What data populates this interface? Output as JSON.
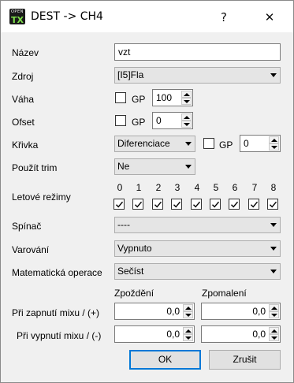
{
  "window": {
    "title": "DEST -> CH4",
    "icon": {
      "small": "OPEN",
      "big": "TX"
    },
    "help_label": "?",
    "close_label": "✕"
  },
  "form": {
    "name": {
      "label": "Název",
      "value": "vzt"
    },
    "source": {
      "label": "Zdroj",
      "value": "[I5]Fla"
    },
    "weight": {
      "label": "Váha",
      "gp_label": "GP",
      "gp_checked": false,
      "value": "100"
    },
    "offset": {
      "label": "Ofset",
      "gp_label": "GP",
      "gp_checked": false,
      "value": "0"
    },
    "curve": {
      "label": "Křivka",
      "type": "Diferenciace",
      "gp_label": "GP",
      "gp_checked": false,
      "value": "0"
    },
    "use_trim": {
      "label": "Použít trim",
      "value": "Ne"
    },
    "flight_modes": {
      "label": "Letové režimy",
      "modes": [
        {
          "num": "0",
          "checked": true
        },
        {
          "num": "1",
          "checked": true
        },
        {
          "num": "2",
          "checked": true
        },
        {
          "num": "3",
          "checked": true
        },
        {
          "num": "4",
          "checked": true
        },
        {
          "num": "5",
          "checked": true
        },
        {
          "num": "6",
          "checked": true
        },
        {
          "num": "7",
          "checked": true
        },
        {
          "num": "8",
          "checked": true
        }
      ]
    },
    "switch": {
      "label": "Spínač",
      "value": "----"
    },
    "warning": {
      "label": "Varování",
      "value": "Vypnuto"
    },
    "math_op": {
      "label": "Matematická operace",
      "value": "Sečíst"
    },
    "delay_header": "Zpoždění",
    "slow_header": "Zpomalení",
    "mix_on": {
      "label": "Při zapnutí mixu / (+)",
      "delay": "0,0",
      "slow": "0,0"
    },
    "mix_off": {
      "label": "Při vypnutí mixu / (-)",
      "delay": "0,0",
      "slow": "0,0"
    }
  },
  "buttons": {
    "ok": "OK",
    "cancel": "Zrušit"
  },
  "colors": {
    "accent": "#0078d7",
    "icon_green": "#7ee04b"
  }
}
